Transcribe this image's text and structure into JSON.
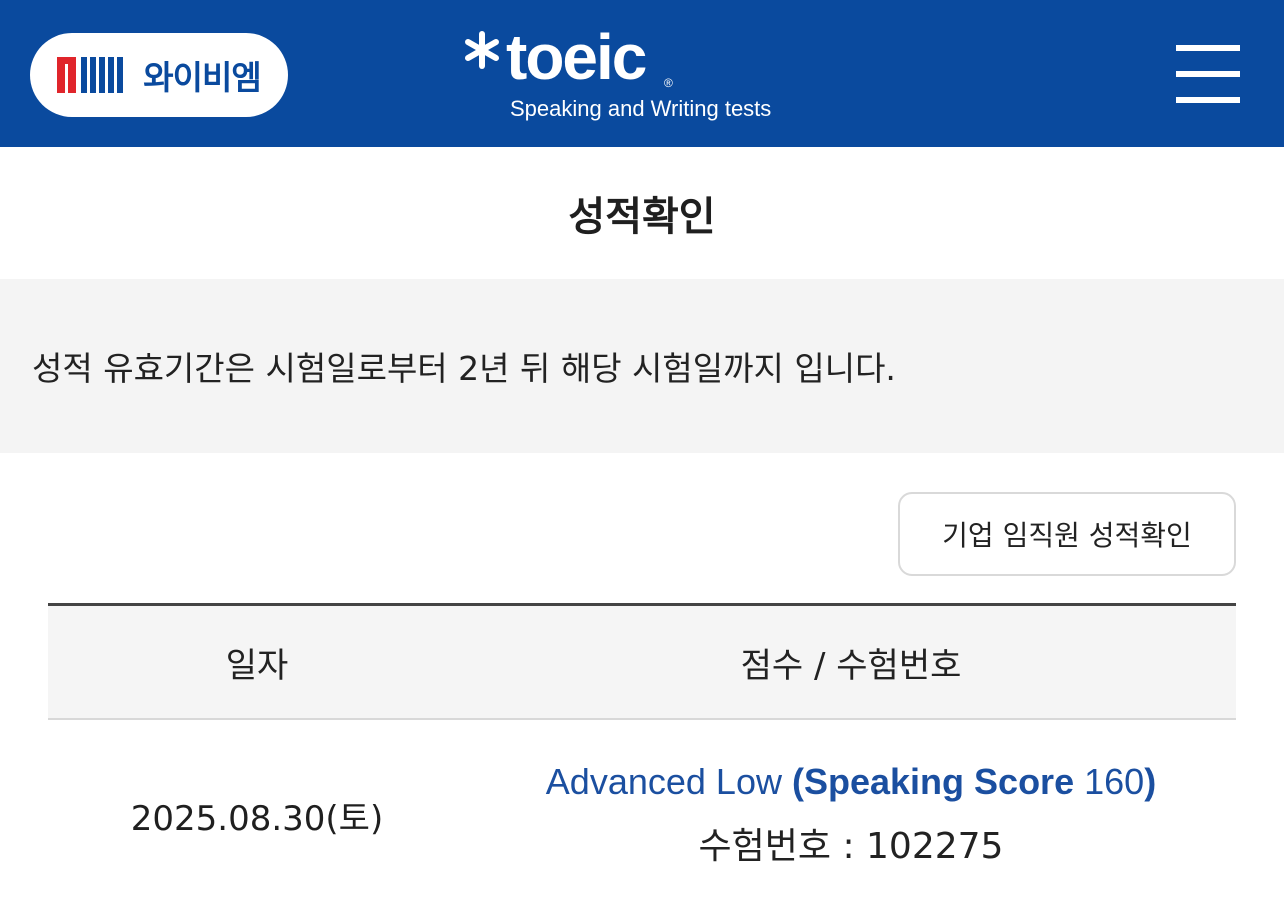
{
  "header": {
    "ybm_logo_text": "와이비엠",
    "toeic_word": "toeic",
    "toeic_reg": "®",
    "toeic_subtitle": "Speaking and Writing tests",
    "brand_color": "#0a4a9e",
    "ybm_red": "#e0252b"
  },
  "page": {
    "title": "성적확인",
    "notice": "성적 유효기간은 시험일로부터 2년 뒤 해당 시험일까지 입니다.",
    "corp_button_label": "기업 임직원 성적확인"
  },
  "table": {
    "headers": [
      "일자",
      "점수 / 수험번호"
    ],
    "rows": [
      {
        "date": "2025.08.30(토)",
        "level": "Advanced Low",
        "paren_open": "(",
        "score_label": "Speaking Score",
        "score_value": "160",
        "paren_close": ")",
        "exam_label": "수험번호 : ",
        "exam_number": "102275"
      }
    ]
  }
}
